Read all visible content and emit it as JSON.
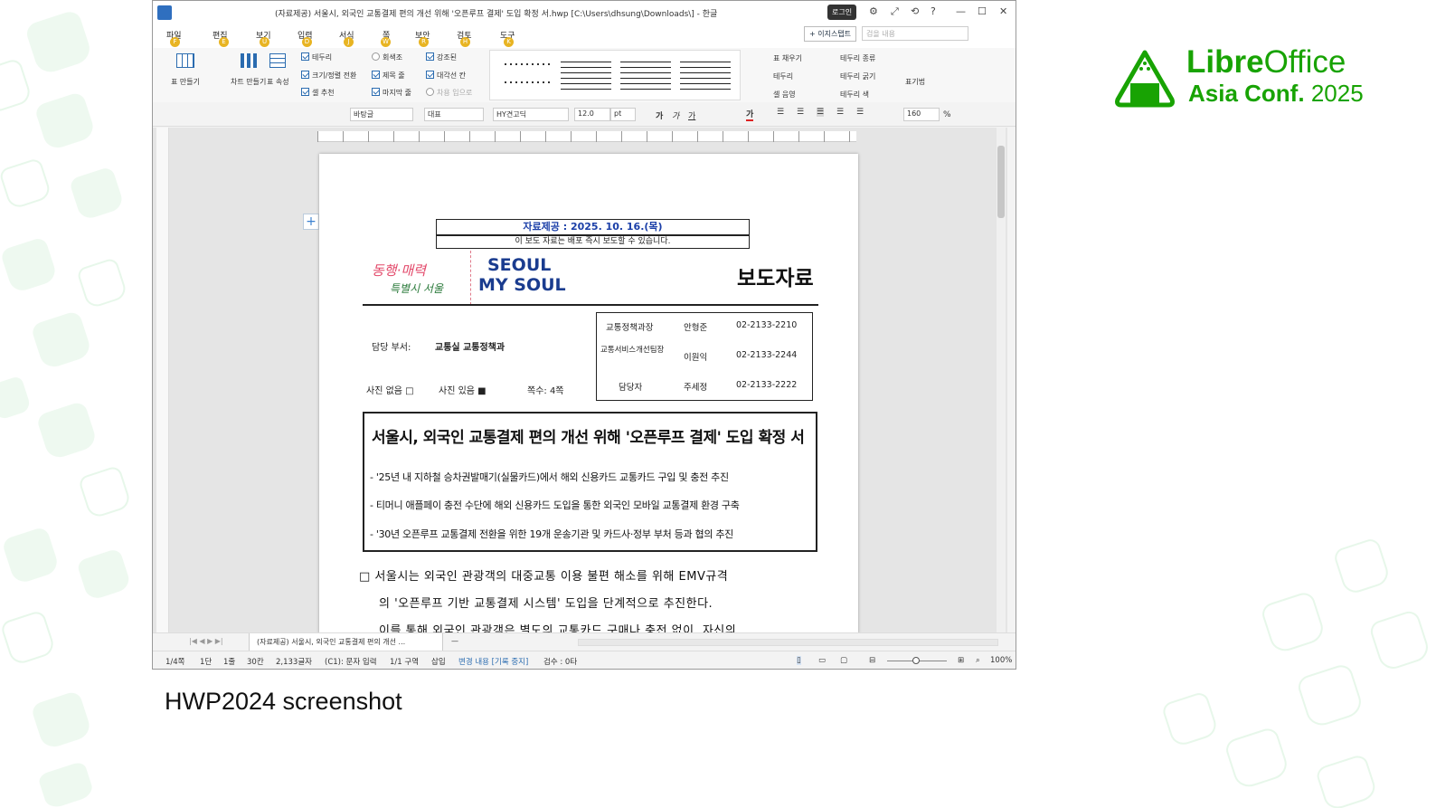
{
  "window": {
    "title": "(자료제공) 서울시, 외국인 교통결제 편의 개선 위해 '오픈루프 결제' 도입 확정 서.hwp [C:\\Users\\dhsung\\Downloads\\] - 한글",
    "login_label": "로그인",
    "window_buttons": [
      "□",
      "⤢",
      "⟲",
      "?",
      "—",
      "☐",
      "✕"
    ]
  },
  "menubar": {
    "items": [
      {
        "label": "파일",
        "key": "F"
      },
      {
        "label": "편집",
        "key": "E"
      },
      {
        "label": "보기",
        "key": "U"
      },
      {
        "label": "입력",
        "key": "D"
      },
      {
        "label": "서식",
        "key": "J"
      },
      {
        "label": "쪽",
        "key": "W"
      },
      {
        "label": "보안",
        "key": "R"
      },
      {
        "label": "검토",
        "key": "H"
      },
      {
        "label": "도구",
        "key": "K"
      }
    ],
    "assistant_label": "+ 이지스탭트",
    "search_placeholder": "검을 내용"
  },
  "ribbon": {
    "left_groups": [
      {
        "label": "표 만들기"
      },
      {
        "label": "차트 만들기"
      },
      {
        "label": "표 속성"
      }
    ],
    "checkboxes": [
      {
        "label": "테두리",
        "checked": true
      },
      {
        "label": "회색조",
        "checked": false
      },
      {
        "label": "강조된",
        "checked": true
      },
      {
        "label": "크기/정렬 전환",
        "checked": true
      },
      {
        "label": "제목 줄",
        "checked": true
      },
      {
        "label": "대각선 칸",
        "checked": true
      },
      {
        "label": "셀 추천",
        "checked": true
      },
      {
        "label": "마지막 줄",
        "checked": true
      },
      {
        "label": "차용 입으로",
        "checked": false
      }
    ],
    "right_items": [
      {
        "label": "표 채우기"
      },
      {
        "label": "테두리 종류"
      },
      {
        "label": "테두리"
      },
      {
        "label": "테두리 굵기"
      },
      {
        "label": "셀 음영"
      },
      {
        "label": "테두리 색"
      },
      {
        "label": "표기법"
      }
    ]
  },
  "formatbar": {
    "style": "바탕글",
    "font_lang": "대표",
    "font": "HY견고딕",
    "size": "12.0",
    "unit": "pt",
    "line_spacing": "160",
    "percent": "%"
  },
  "document": {
    "release_date": "자료제공 : 2025. 10. 16.(목)",
    "embargo": "이 보도 자료는 배포 즉시 보도할 수 있습니다.",
    "logo_left": "동행·매력",
    "logo_left_sub": "특별시 서울",
    "logo_seoul_top": "SEOUL",
    "logo_seoul_bottom": "MY SOUL",
    "doc_type": "보도자료",
    "dept_label": "담당 부서:",
    "dept_value": "교통실 교통정책과",
    "photo_none": "사진 없음 □",
    "photo_yes": "사진 있음 ■",
    "pages": "쪽수: 4쪽",
    "contacts": [
      {
        "role": "교통정책과장",
        "name": "안형준",
        "phone": "02-2133-2210"
      },
      {
        "role": "교통서비스개선팀장",
        "name": "이원익",
        "phone": "02-2133-2244"
      },
      {
        "role": "담당자",
        "name": "주세정",
        "phone": "02-2133-2222"
      }
    ],
    "headline": "서울시, 외국인 교통결제 편의 개선 위해 '오픈루프 결제' 도입 확정 서",
    "subs": [
      "- '25년 내 지하철 승차권발매기(실물카드)에서 해외 신용카드 교통카드 구입 및 충전 추진",
      "- 티머니 애플페이 충전 수단에 해외 신용카드 도입을 통한 외국인 모바일 교통결제 환경 구축",
      "- '30년 오픈루프 교통결제 전환을 위한 19개 운송기관 및 카드사·정부 부처 등과 협의 추진"
    ],
    "para1": "□ 서울시는 외국인 관광객의 대중교통 이용 불편 해소를 위해 EMV규격",
    "para2": "의 '오픈루프 기반 교통결제 시스템' 도입을 단계적으로 추진한다.",
    "para3": "이를 통해 외국인 관광객은 별도의 교통카드 구매나 충전 없이, 자신의"
  },
  "tabs": {
    "doc_tab": "(자료제공) 서울시, 외국인 교통결제 편의 개선 ..."
  },
  "statusbar": {
    "page": "1/4쪽",
    "section": "1단",
    "line": "1줄",
    "col": "30칸",
    "chars": "2,133글자",
    "input": "(C1): 문자 입력",
    "sec": "1/1 구역",
    "mode": "삽입",
    "track": "변경 내용 [기록 중지]",
    "errors": "검수 : 0타",
    "zoom": "100%"
  },
  "slide": {
    "caption": "HWP2024 screenshot",
    "logo_line1_bold": "Libre",
    "logo_line1_light": "Office",
    "logo_line2_bold": "Asia Conf.",
    "logo_line2_light": "2025",
    "brand_color": "#18a303"
  }
}
